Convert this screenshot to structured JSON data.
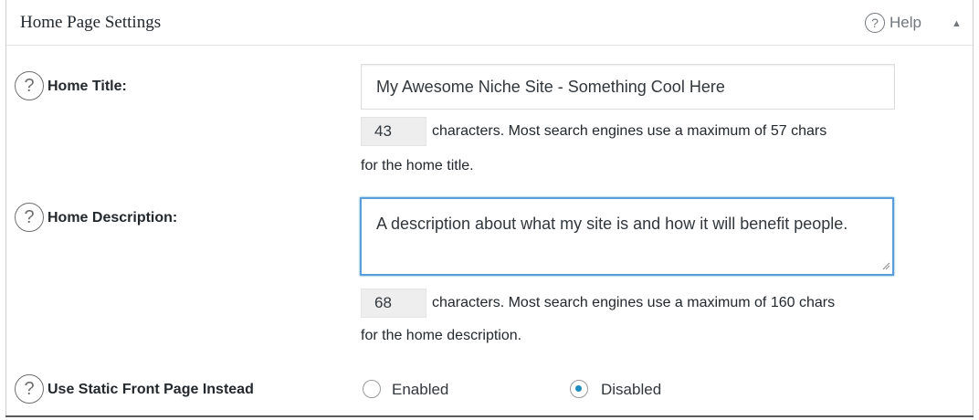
{
  "header": {
    "title": "Home Page Settings",
    "help_label": "Help",
    "collapse_icon": "triangle-up-icon"
  },
  "fields": {
    "home_title": {
      "label": "Home Title:",
      "value": "My Awesome Niche Site - Something Cool Here",
      "count": "43",
      "hint_line1": "characters. Most search engines use a maximum of 57 chars",
      "hint_line2": "for the home title."
    },
    "home_description": {
      "label": "Home Description:",
      "value": "A description about what my site is and how it will benefit people.",
      "count": "68",
      "hint_line1": "characters. Most search engines use a maximum of 160 chars",
      "hint_line2": "for the home description."
    },
    "static_front_page": {
      "label": "Use Static Front Page Instead",
      "options": [
        "Enabled",
        "Disabled"
      ],
      "selected": "Disabled"
    }
  },
  "colors": {
    "accent": "#1e8cbe",
    "focus_border": "#5b9dd9"
  }
}
